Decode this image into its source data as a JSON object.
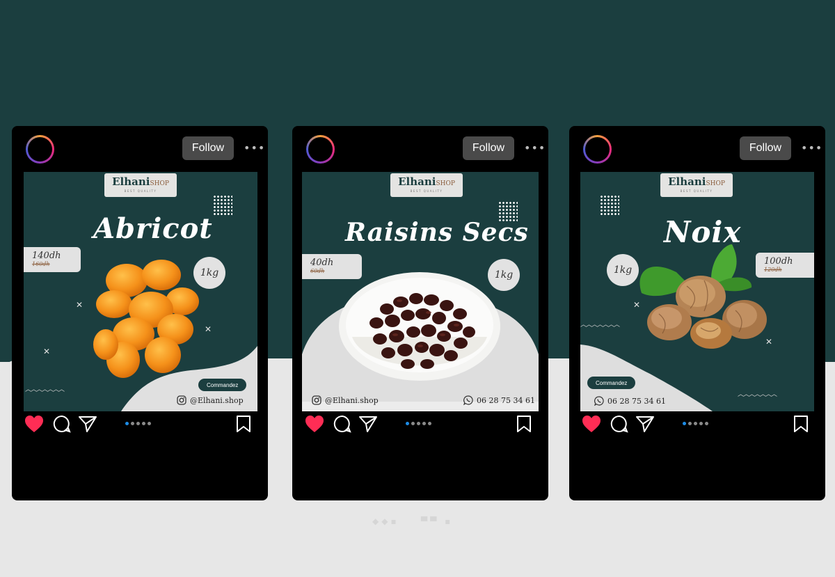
{
  "follow_label": "Follow",
  "more_label": "•••",
  "brand": {
    "name": "Elhani",
    "suffix": "SHOP",
    "tagline": "BEST QUALITY"
  },
  "colors": {
    "teal": "#1b3e3f",
    "like": "#ff2d55",
    "dot_active": "#1d8ce6"
  },
  "posts": [
    {
      "title": "Abricot",
      "price": "140dh",
      "old_price": "160dh",
      "weight": "1kg",
      "cta": "Commandez",
      "contact": "@Elhani.shop",
      "contact_icon": "instagram-icon"
    },
    {
      "title": "Raisins Secs",
      "price": "40dh",
      "old_price": "60dh",
      "weight": "1kg",
      "contact": "@Elhani.shop",
      "contact_icon": "instagram-icon",
      "phone": "06 28 75 34 61",
      "phone_icon": "whatsapp-icon"
    },
    {
      "title": "Noix",
      "price": "100dh",
      "old_price": "120dh",
      "weight": "1kg",
      "cta": "Commandez",
      "phone": "06 28 75 34 61",
      "phone_icon": "whatsapp-icon"
    }
  ],
  "action_icons": [
    "heart-icon",
    "comment-icon",
    "share-icon",
    "bookmark-icon"
  ],
  "carousel": {
    "total": 5,
    "active": 1
  }
}
